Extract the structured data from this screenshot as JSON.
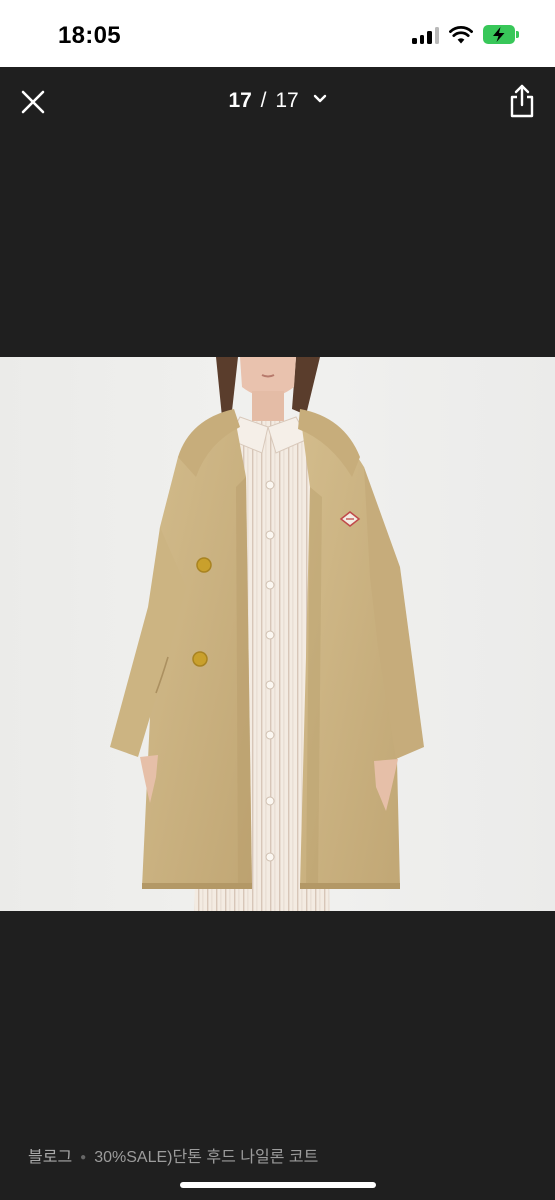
{
  "status_bar": {
    "time": "18:05",
    "icons": [
      "signal-icon",
      "wifi-icon",
      "battery-charging-icon"
    ]
  },
  "viewer": {
    "current_page": "17",
    "separator": "/",
    "total_pages": "17",
    "icons": {
      "close": "close-icon",
      "dropdown": "chevron-down-icon",
      "share": "share-icon"
    }
  },
  "caption": {
    "source": "블로그",
    "title": "30%SALE)단톤 후드 나일론 코트"
  },
  "colors": {
    "background": "#1f1f1f",
    "status_bar": "#ffffff",
    "battery": "#38c759",
    "caption_text": "#9c9c9c"
  }
}
